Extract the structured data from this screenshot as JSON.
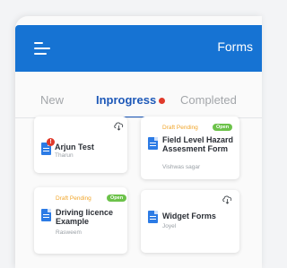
{
  "appbar": {
    "title": "Forms",
    "menu_icon": "hamburger-menu-icon",
    "color": "#1673d3"
  },
  "tabs": [
    {
      "label": "New",
      "active": false
    },
    {
      "label": "Inprogress",
      "active": true,
      "has_alert_dot": true
    },
    {
      "label": "Completed",
      "active": false
    }
  ],
  "cards": [
    {
      "title": "Arjun Test",
      "author": "Tharun",
      "status": "",
      "badge": "",
      "has_alert": true,
      "alert_text": "!",
      "icon": "document-icon",
      "action_icon": "cloud-download-icon"
    },
    {
      "title": "Field Level Hazard Assesment Form",
      "author": "Vishwas sagar",
      "status": "Draft Pending",
      "badge": "Open",
      "has_alert": false,
      "icon": "document-icon",
      "action_icon": ""
    },
    {
      "title": "Driving licence Example",
      "author": "Rasweem",
      "status": "Draft Pending",
      "badge": "Open",
      "has_alert": false,
      "icon": "document-icon",
      "action_icon": ""
    },
    {
      "title": "Widget Forms",
      "author": "Joyel",
      "status": "",
      "badge": "",
      "has_alert": false,
      "icon": "document-icon",
      "action_icon": "cloud-download-icon"
    }
  ],
  "colors": {
    "accent": "#1d58b8",
    "draft": "#f0a52a",
    "open": "#6cc24a",
    "alert": "#e03a2b"
  }
}
